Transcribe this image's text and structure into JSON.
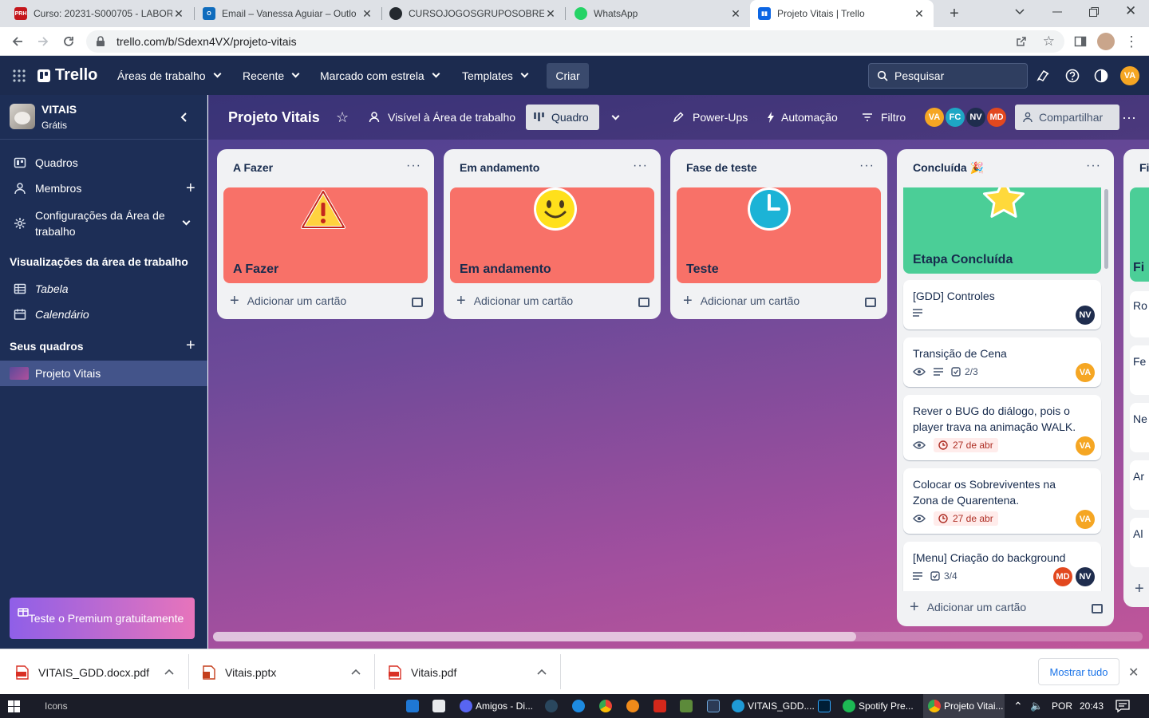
{
  "browser": {
    "tabs": [
      {
        "title": "Curso: 20231-S000705 - LABOR",
        "favicon": "course-favicon"
      },
      {
        "title": "Email – Vanessa Aguiar – Outlo",
        "favicon": "outlook-favicon"
      },
      {
        "title": "CURSOJOGOSGRUPOSOBREVIV",
        "favicon": "github-favicon"
      },
      {
        "title": "WhatsApp",
        "favicon": "whatsapp-favicon"
      },
      {
        "title": "Projeto Vitais | Trello",
        "favicon": "trello-favicon",
        "active": true
      }
    ],
    "url": "trello.com/b/Sdexn4VX/projeto-vitais"
  },
  "header": {
    "logo": "Trello",
    "menus": [
      "Áreas de trabalho",
      "Recente",
      "Marcado com estrela",
      "Templates"
    ],
    "create_label": "Criar",
    "search_placeholder": "Pesquisar",
    "user_initials": "VA"
  },
  "sidebar": {
    "workspace_name": "VITAIS",
    "workspace_plan": "Grátis",
    "items": [
      {
        "label": "Quadros",
        "icon": "boards-icon"
      },
      {
        "label": "Membros",
        "icon": "members-icon"
      },
      {
        "label": "Configurações da Área de trabalho",
        "icon": "settings-icon"
      }
    ],
    "views_heading": "Visualizações da área de trabalho",
    "views": [
      {
        "label": "Tabela",
        "icon": "table-icon"
      },
      {
        "label": "Calendário",
        "icon": "calendar-icon"
      }
    ],
    "boards_heading": "Seus quadros",
    "boards": [
      {
        "label": "Projeto Vitais"
      }
    ],
    "premium_label": "Teste o Premium gratuitamente"
  },
  "board": {
    "title": "Projeto Vitais",
    "visibility": "Visível à Área de trabalho",
    "view": "Quadro",
    "powerups": "Power-Ups",
    "automation": "Automação",
    "filter": "Filtro",
    "members": [
      {
        "initials": "VA",
        "color": "#f5a623"
      },
      {
        "initials": "FC",
        "color": "#1ea7c5"
      },
      {
        "initials": "NV",
        "color": "#1f2d4e"
      },
      {
        "initials": "MD",
        "color": "#e2481f"
      }
    ],
    "share": "Compartilhar",
    "add_card": "Adicionar um cartão",
    "lists": [
      {
        "title": "A Fazer",
        "cover_title": "A Fazer",
        "cover_icon": "warning-icon",
        "cover_color": "#f87168"
      },
      {
        "title": "Em andamento",
        "cover_title": "Em andamento",
        "cover_icon": "smiley-icon",
        "cover_color": "#f87168"
      },
      {
        "title": "Fase de teste",
        "cover_title": "Teste",
        "cover_icon": "clock-icon",
        "cover_color": "#f87168"
      },
      {
        "title": "Concluída 🎉",
        "cover_title": "Etapa Concluída",
        "cover_icon": "star-icon",
        "cover_color": "#4bce97",
        "cards": [
          {
            "title": "[GDD] Controles",
            "members": [
              "NV"
            ]
          },
          {
            "title": "Transição de Cena",
            "checklist": "2/3",
            "members": [
              "VA"
            ]
          },
          {
            "title": "Rever o BUG do diálogo, pois o player trava na animação WALK.",
            "due": "27 de abr",
            "members": [
              "VA"
            ]
          },
          {
            "title": "Colocar os Sobreviventes na Zona de Quarentena.",
            "due": "27 de abr",
            "members": [
              "VA"
            ]
          },
          {
            "title": "[Menu] Criação do background",
            "checklist": "3/4",
            "members": [
              "MD",
              "NV"
            ]
          }
        ]
      }
    ],
    "partial_list": {
      "title": "Fi",
      "cover_title": "Fi",
      "card_fragments": [
        "Ro",
        "Fe",
        "Ne",
        "Ar",
        "Al"
      ]
    }
  },
  "downloads": {
    "items": [
      {
        "name": "VITAIS_GDD.docx.pdf",
        "type": "pdf"
      },
      {
        "name": "Vitais.pptx",
        "type": "pptx"
      },
      {
        "name": "Vitais.pdf",
        "type": "pdf"
      }
    ],
    "show_all": "Mostrar tudo"
  },
  "taskbar": {
    "search_text": "Icons",
    "apps": [
      "Amigos - Di...",
      "VITAIS_GDD....",
      "Spotify Pre...",
      "Projeto Vitai..."
    ],
    "language": "POR",
    "time": "20:43"
  }
}
